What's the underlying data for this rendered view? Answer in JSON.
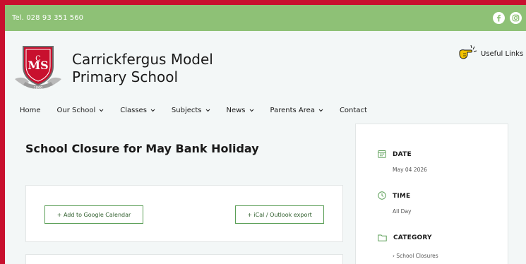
{
  "topbar": {
    "phone": "Tel. 028 93 351 560",
    "social": [
      {
        "name": "facebook",
        "glyph": "f"
      },
      {
        "name": "instagram",
        "glyph": "instagram-icon"
      }
    ]
  },
  "header": {
    "crest_ribbon": "1860",
    "school_name_line1": "Carrickfergus Model",
    "school_name_line2": "Primary School",
    "useful_links": "Useful Links"
  },
  "nav": {
    "items": [
      {
        "label": "Home",
        "dropdown": false
      },
      {
        "label": "Our School",
        "dropdown": true
      },
      {
        "label": "Classes",
        "dropdown": true
      },
      {
        "label": "Subjects",
        "dropdown": true
      },
      {
        "label": "News",
        "dropdown": true
      },
      {
        "label": "Parents Area",
        "dropdown": true
      },
      {
        "label": "Contact",
        "dropdown": false
      }
    ]
  },
  "event": {
    "title": "School Closure for May Bank Holiday",
    "google_button": "+ Add to Google Calendar",
    "ical_button": "+ iCal / Outlook export"
  },
  "sidebar": {
    "date_label": "DATE",
    "date_value": "May 04 2026",
    "time_label": "TIME",
    "time_value": "All Day",
    "category_label": "CATEGORY",
    "category_value": "› School Closures"
  },
  "colors": {
    "frame": "#c8102e",
    "topbar": "#8ec176",
    "button_border": "#5a9e56",
    "background": "#f3f7f7"
  }
}
